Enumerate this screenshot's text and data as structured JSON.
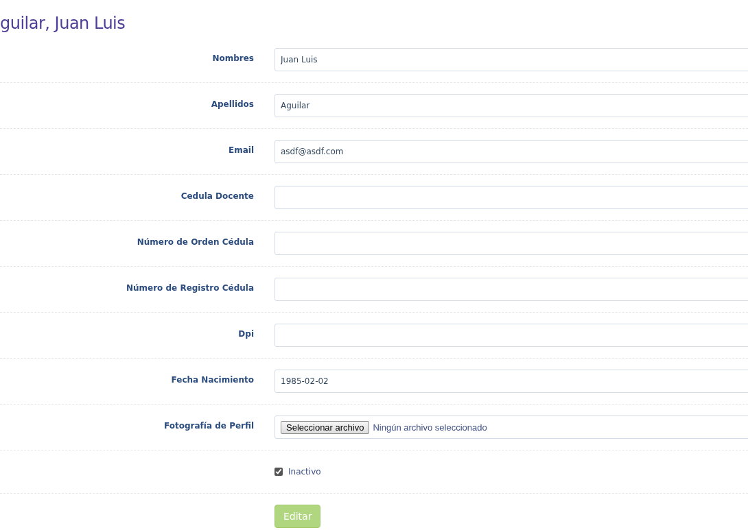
{
  "title": "guilar, Juan Luis",
  "fields": [
    {
      "kind": "text",
      "label": "Nombres",
      "value": "Juan Luis"
    },
    {
      "kind": "text",
      "label": "Apellidos",
      "value": "Aguilar"
    },
    {
      "kind": "text",
      "label": "Email",
      "value": "asdf@asdf.com"
    },
    {
      "kind": "text",
      "label": "Cedula Docente"
    },
    {
      "kind": "text",
      "label": "Número de Orden Cédula"
    },
    {
      "kind": "text",
      "label": "Número de Registro Cédula"
    },
    {
      "kind": "text",
      "label": "Dpi"
    },
    {
      "kind": "text",
      "label": "Fecha Nacimiento",
      "value": "1985-02-02"
    },
    {
      "kind": "file",
      "label": "Fotografía de Perfil",
      "button": "Seleccionar archivo",
      "status": "Ningún archivo seleccionado"
    },
    {
      "kind": "checkbox",
      "text": "Inactivo",
      "checked": true
    }
  ],
  "submit": {
    "label": "Editar",
    "disabled": true
  }
}
